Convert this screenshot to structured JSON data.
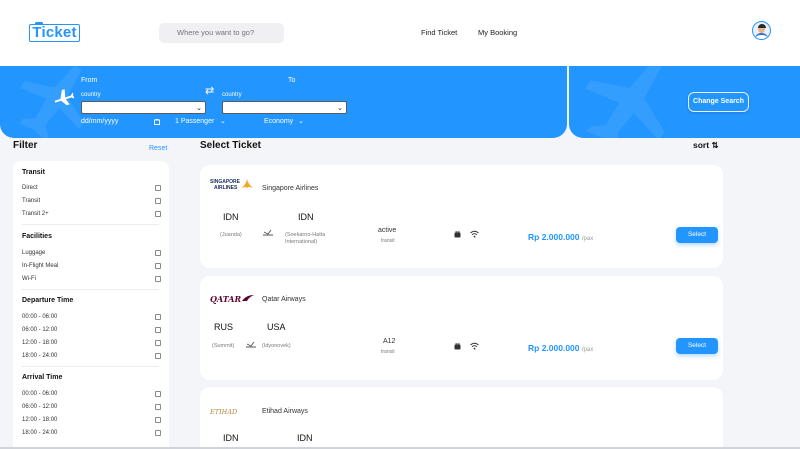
{
  "header": {
    "logo": "Ticket",
    "search_placeholder": "Where you want to go?",
    "nav_find": "Find Ticket",
    "nav_booking": "My Booking"
  },
  "search_band": {
    "from_label": "From",
    "to_label": "To",
    "from_country_label": "country",
    "to_country_label": "country",
    "date_placeholder": "dd/mm/yyyy",
    "passenger": "1 Passenger",
    "class": "Economy",
    "change_button": "Change Search"
  },
  "filter": {
    "title": "Filter",
    "reset": "Reset",
    "sections": [
      {
        "title": "Transit",
        "items": [
          "Direct",
          "Transit",
          "Transit 2+"
        ]
      },
      {
        "title": "Facilities",
        "items": [
          "Luggage",
          "In-Flight Meal",
          "Wi-Fi"
        ]
      },
      {
        "title": "Departure Time",
        "items": [
          "00:00 - 06:00",
          "06:00 - 12:00",
          "12:00 - 18:00",
          "18:00 - 24:00"
        ]
      },
      {
        "title": "Arrival Time",
        "items": [
          "00:00 - 06:00",
          "06:00 - 12:00",
          "12:00 - 18:00",
          "18:00 - 24:00"
        ]
      }
    ]
  },
  "main": {
    "title": "Select Ticket",
    "sort": "sort"
  },
  "tickets": [
    {
      "airline": "Singapore Airlines",
      "logo_text_1": "SINGAPORE",
      "logo_text_2": "AIRLINES",
      "from_code": "IDN",
      "to_code": "IDN",
      "from_city": "(Juanda)",
      "to_city_1": "(Soekarno-Hatta",
      "to_city_2": "International)",
      "status": "active",
      "transit": "transit",
      "price": "Rp 2.000.000",
      "pax": "/pax",
      "select": "Select"
    },
    {
      "airline": "Qatar Airways",
      "logo_text_1": "QATAR",
      "from_code": "RUS",
      "to_code": "USA",
      "from_city": "(Summit)",
      "to_city_1": "(Idyonovek)",
      "status": "A12",
      "transit": "transit",
      "price": "Rp 2.000.000",
      "pax": "/pax",
      "select": "Select"
    },
    {
      "airline": "Etihad Airways",
      "logo_text_1": "ETIHAD",
      "logo_text_2": "",
      "from_code": "IDN",
      "to_code": "IDN"
    }
  ],
  "colors": {
    "primary": "#2395ff",
    "background": "#f4f5f9"
  }
}
